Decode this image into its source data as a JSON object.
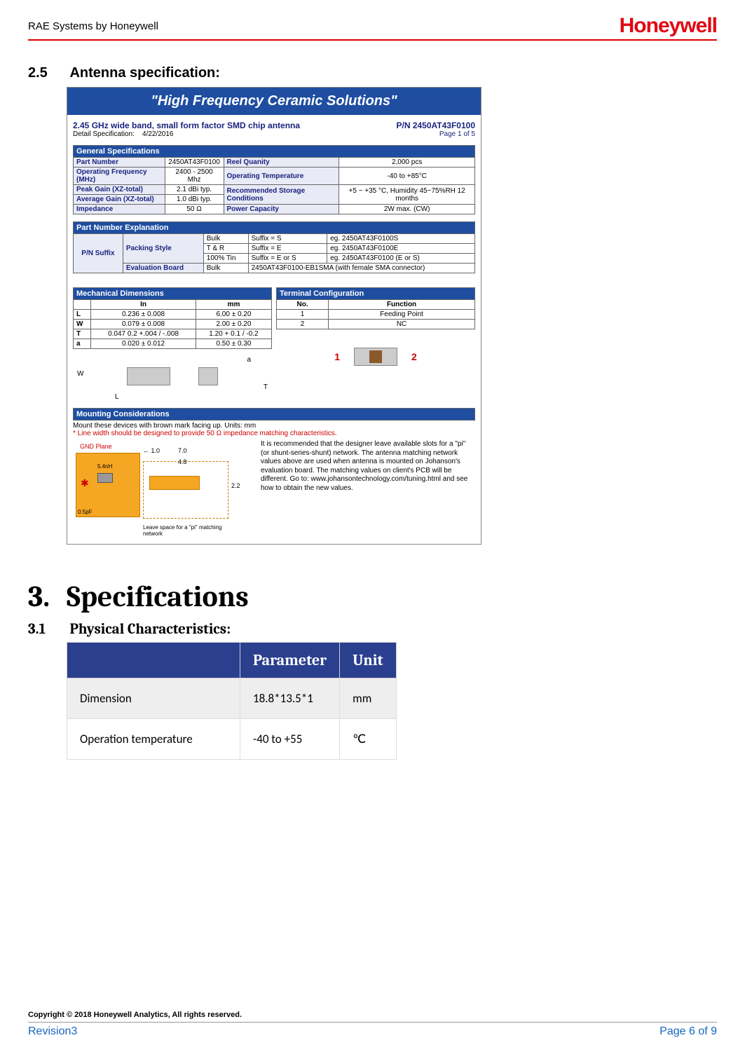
{
  "header": {
    "left": "RAE Systems by Honeywell",
    "logo": "Honeywell"
  },
  "sec25": {
    "num": "2.5",
    "title": "Antenna specification:"
  },
  "datasheet": {
    "banner": "\"High Frequency Ceramic Solutions\"",
    "title_left": "2.45 GHz wide band, small form factor SMD chip antenna",
    "pn_right": "P/N 2450AT43F0100",
    "detail_label": "Detail Specification:",
    "detail_date": "4/22/2016",
    "page_label": "Page 1 of 5",
    "gen_hdr": "General Specifications",
    "gen": {
      "r1a": "Part Number",
      "r1b": "2450AT43F0100",
      "r1c": "Reel Quanity",
      "r1d": "2,000 pcs",
      "r2a": "Operating Frequency (MHz)",
      "r2b": "2400 - 2500 Mhz",
      "r2c": "Operating Temperature",
      "r2d": "-40 to +85°C",
      "r3a": "Peak Gain (XZ-total)",
      "r3b": "2.1 dBi typ.",
      "r3c": "Recommended Storage Conditions",
      "r3d": "+5 ~ +35 °C, Humidity 45~75%RH 12 months",
      "r4a": "Average Gain (XZ-total)",
      "r4b": "1.0 dBi typ.",
      "r5a": "Impedance",
      "r5b": "50 Ω",
      "r5c": "Power Capacity",
      "r5d": "2W max. (CW)"
    },
    "pne_hdr": "Part Number Explanation",
    "pne": {
      "suffix": "P/N Suffix",
      "packing": "Packing Style",
      "bulk": "Bulk",
      "sS": "Suffix = S",
      "egS": "eg. 2450AT43F0100S",
      "tr": "T & R",
      "sE": "Suffix = E",
      "egE": "eg. 2450AT43F0100E",
      "tin": "100% Tin",
      "sES": "Suffix = E or S",
      "egES": "eg. 2450AT43F0100 (E or S)",
      "eval": "Evaluation Board",
      "bulk2": "Bulk",
      "evalpn": "2450AT43F0100-EB1SMA (with female SMA connector)"
    },
    "mech_hdr": "Mechanical Dimensions",
    "mech": {
      "in": "In",
      "mm": "mm",
      "L": "L",
      "Lin": "0.236  ±  0.008",
      "Lmm": "6.00  ±  0.20",
      "W": "W",
      "Win": "0.079  ±  0.008",
      "Wmm": "2.00  ±  0.20",
      "T": "T",
      "Tin": "0.047 0.2 +.004 / -.008",
      "Tmm": "1.20 + 0.1 / -0.2",
      "a": "a",
      "ain": "0.020  ±  0.012",
      "amm": "0.50  ±  0.30"
    },
    "term_hdr": "Terminal Configuration",
    "term": {
      "no": "No.",
      "func": "Function",
      "n1": "1",
      "f1": "Feeding Point",
      "n2": "2",
      "f2": "NC",
      "left": "1",
      "right": "2"
    },
    "mount_hdr": "Mounting Considerations",
    "mount_line1": "Mount these devices with brown mark facing up. Units: mm",
    "mount_line2": "* Line width should be designed to provide 50 Ω impedance matching characteristics.",
    "gndplane": "GND Plane",
    "d_10": "1.0",
    "d_70": "7.0",
    "d_48": "4.8",
    "d_22": "2.2",
    "d_54nH": "5.4nH",
    "d_05pF": "0.5pF",
    "pi_note": "Leave space for a \"pi\" matching network",
    "mount_text": "It is recommended that the designer leave available slots for a \"pi\" (or shunt-series-shunt) network. The antenna matching network values above are used when antenna is mounted on Johanson's evaluation board. The matching values on client's PCB will be different. Go to: www.johansontechnology.com/tuning.html and see how to obtain the new values."
  },
  "h3": {
    "num": "3.",
    "title": "Specifications"
  },
  "sec31": {
    "num": "3.1",
    "title": "Physical Characteristics:"
  },
  "phys_table": {
    "h_param": "Parameter",
    "h_unit": "Unit",
    "r1_label": "Dimension",
    "r1_param": "18.8*13.5*1",
    "r1_unit": "mm",
    "r2_label": "Operation temperature",
    "r2_param": "-40 to +55",
    "r2_unit": "℃"
  },
  "footer": {
    "copyright": "Copyright © 2018 Honeywell Analytics, All rights reserved.",
    "revision": "Revision3",
    "page": "Page 6 of 9"
  }
}
